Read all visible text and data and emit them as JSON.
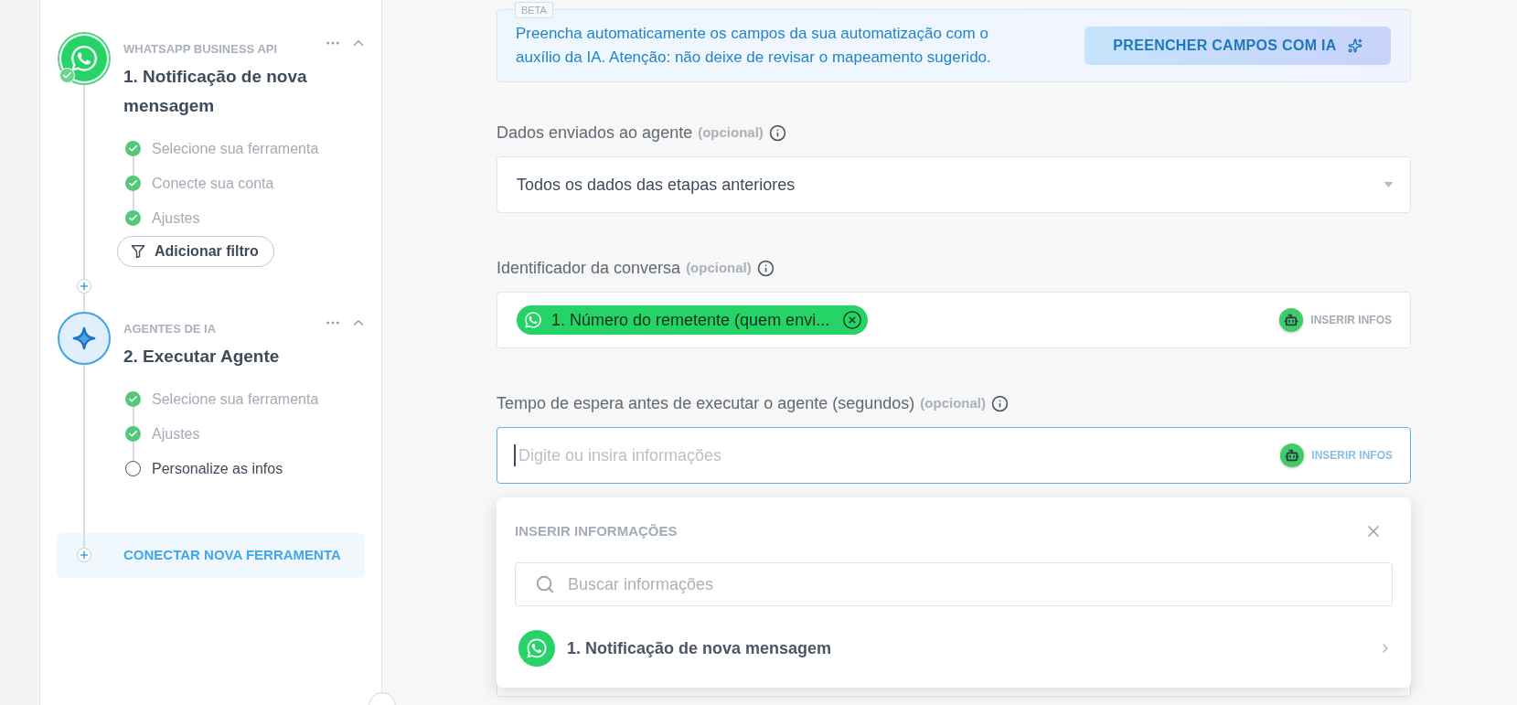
{
  "sidebar": {
    "steps": [
      {
        "kind": "whatsapp",
        "app": "WHATSAPP BUSINESS API",
        "title": "1. Notificação de nova mensagem",
        "completed": true,
        "expanded": true,
        "substeps": [
          {
            "label": "Selecione sua ferramenta",
            "done": true
          },
          {
            "label": "Conecte sua conta",
            "done": true
          },
          {
            "label": "Ajustes",
            "done": true
          }
        ],
        "filter_button": "Adicionar filtro"
      },
      {
        "kind": "ai_agent",
        "app": "AGENTES DE IA",
        "title": "2. Executar Agente",
        "completed": false,
        "expanded": true,
        "substeps": [
          {
            "label": "Selecione sua ferramenta",
            "done": true
          },
          {
            "label": "Ajustes",
            "done": true
          },
          {
            "label": "Personalize as infos",
            "done": false
          }
        ]
      }
    ],
    "connect_button": "CONECTAR NOVA FERRAMENTA"
  },
  "ai_banner": {
    "badge": "BETA",
    "text": "Preencha automaticamente os campos da sua automatização com o auxílio da IA. Atenção: não deixe de revisar o mapeamento sugerido.",
    "button": "PREENCHER CAMPOS COM IA"
  },
  "fields": [
    {
      "kind": "select",
      "label": "Dados enviados ao agente",
      "optional": "(opcional)",
      "value": "Todos os dados das etapas anteriores"
    },
    {
      "kind": "tags",
      "label": "Identificador da conversa",
      "optional": "(opcional)",
      "tags": [
        "1. Número do remetente (quem envi..."
      ],
      "insert_button": "INSERIR INFOS",
      "focused": false
    },
    {
      "kind": "text",
      "label": "Tempo de espera antes de executar o agente (segundos)",
      "optional": "(opcional)",
      "placeholder": "Digite ou insira informações",
      "insert_button": "INSERIR INFOS",
      "focused": true
    }
  ],
  "insert_panel": {
    "title": "INSERIR INFORMAÇÕES",
    "search": {
      "placeholder": "Buscar informações"
    },
    "items": [
      {
        "label": "1. Notificação de nova mensagem"
      }
    ]
  }
}
